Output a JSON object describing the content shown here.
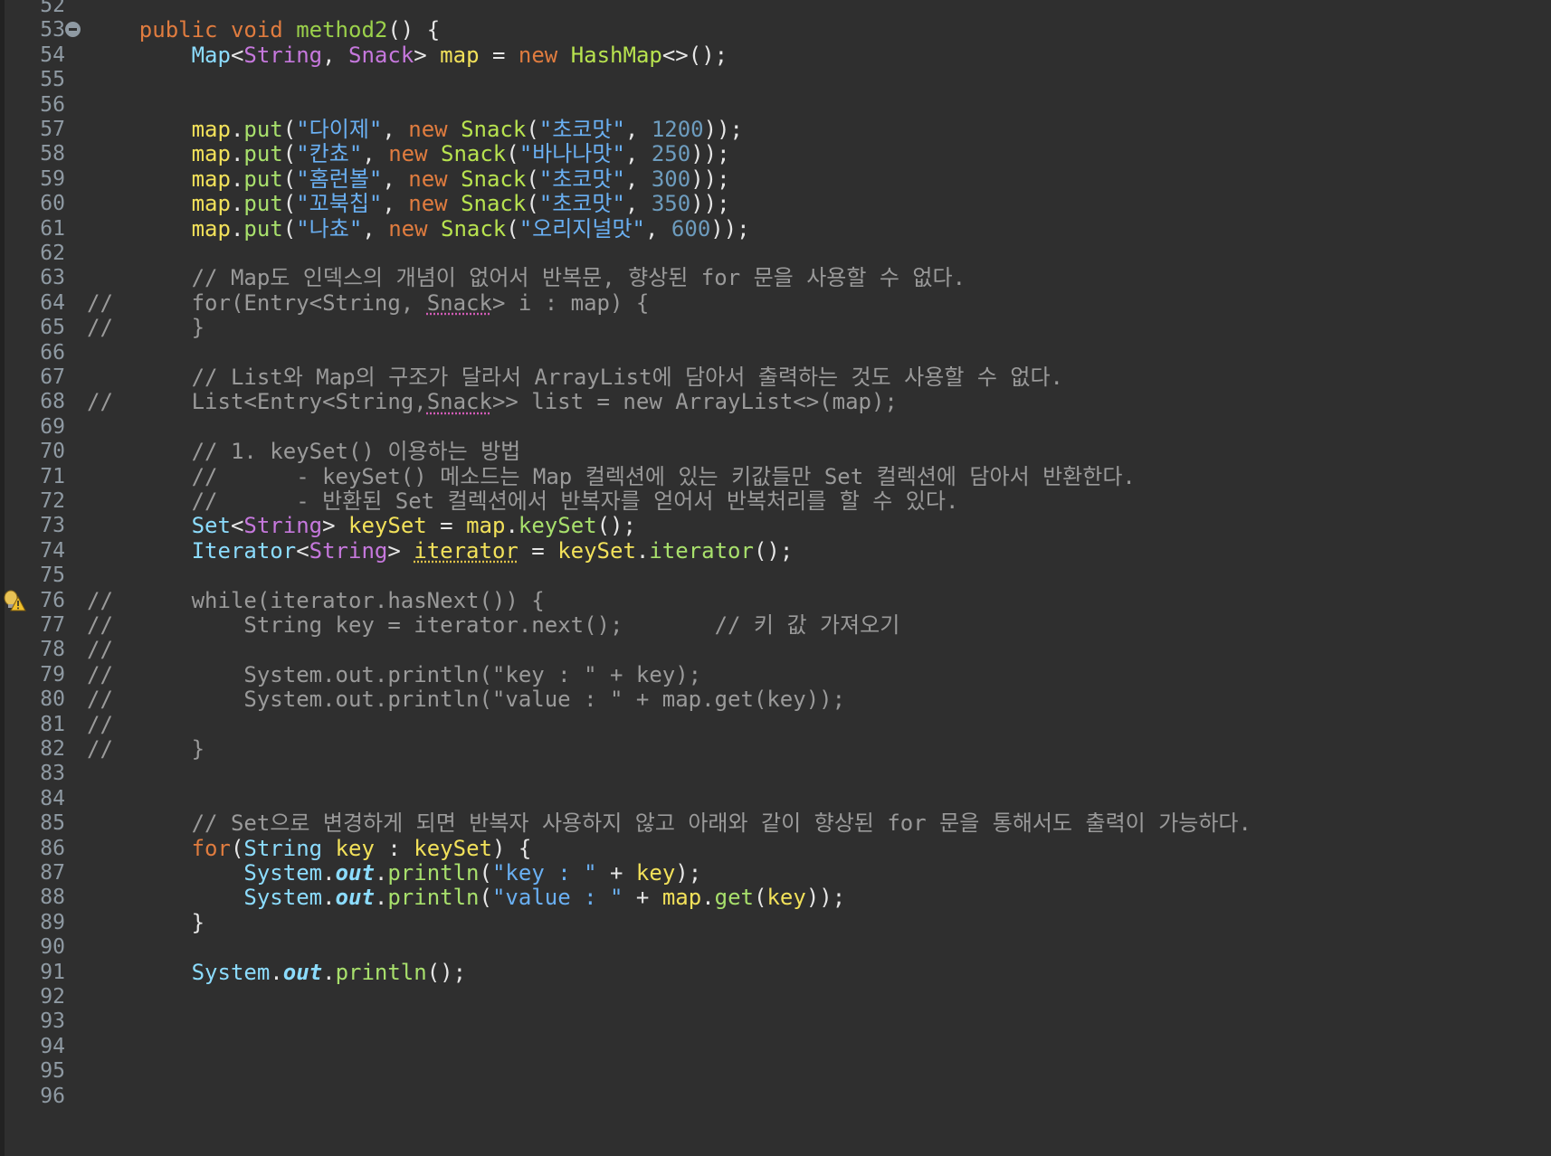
{
  "colors": {
    "background": "#2f2f2f",
    "line_number": "#8f9aa3",
    "keyword": "#e07c3f",
    "method_name": "#9bd14b",
    "interface_type": "#8cdcfe",
    "class_type": "#c678dd",
    "string": "#6ab0f3",
    "constructor": "#b8e34f",
    "local_variable": "#f2e15a",
    "number": "#6d9cbe",
    "method_call": "#a8e06c",
    "comment": "#9a9a9a",
    "plain": "#e6e6e6"
  },
  "icons": {
    "fold": "collapse-minus-icon",
    "warning": "warning-lightbulb-icon"
  },
  "lines": [
    {
      "n": "52",
      "tokens": []
    },
    {
      "n": "53",
      "tokens": [
        {
          "t": "    "
        },
        {
          "t": "public",
          "c": "kw"
        },
        {
          "t": " "
        },
        {
          "t": "void",
          "c": "kw"
        },
        {
          "t": " "
        },
        {
          "t": "method2",
          "c": "method"
        },
        {
          "t": "() {"
        }
      ]
    },
    {
      "n": "54",
      "tokens": [
        {
          "t": "        "
        },
        {
          "t": "Map",
          "c": "iface"
        },
        {
          "t": "<"
        },
        {
          "t": "String",
          "c": "type"
        },
        {
          "t": ", "
        },
        {
          "t": "Snack",
          "c": "type"
        },
        {
          "t": "> "
        },
        {
          "t": "map",
          "c": "field"
        },
        {
          "t": " = "
        },
        {
          "t": "new",
          "c": "kw"
        },
        {
          "t": " "
        },
        {
          "t": "HashMap",
          "c": "ctor"
        },
        {
          "t": "<>();"
        }
      ]
    },
    {
      "n": "55",
      "tokens": []
    },
    {
      "n": "56",
      "tokens": []
    },
    {
      "n": "57",
      "tokens": [
        {
          "t": "        "
        },
        {
          "t": "map",
          "c": "field"
        },
        {
          "t": "."
        },
        {
          "t": "put",
          "c": "call"
        },
        {
          "t": "("
        },
        {
          "t": "\"다이제\"",
          "c": "str"
        },
        {
          "t": ", "
        },
        {
          "t": "new",
          "c": "kw"
        },
        {
          "t": " "
        },
        {
          "t": "Snack",
          "c": "ctor"
        },
        {
          "t": "("
        },
        {
          "t": "\"초코맛\"",
          "c": "str"
        },
        {
          "t": ", "
        },
        {
          "t": "1200",
          "c": "num"
        },
        {
          "t": "));"
        }
      ]
    },
    {
      "n": "58",
      "tokens": [
        {
          "t": "        "
        },
        {
          "t": "map",
          "c": "field"
        },
        {
          "t": "."
        },
        {
          "t": "put",
          "c": "call"
        },
        {
          "t": "("
        },
        {
          "t": "\"칸쵸\"",
          "c": "str"
        },
        {
          "t": ", "
        },
        {
          "t": "new",
          "c": "kw"
        },
        {
          "t": " "
        },
        {
          "t": "Snack",
          "c": "ctor"
        },
        {
          "t": "("
        },
        {
          "t": "\"바나나맛\"",
          "c": "str"
        },
        {
          "t": ", "
        },
        {
          "t": "250",
          "c": "num"
        },
        {
          "t": "));"
        }
      ]
    },
    {
      "n": "59",
      "tokens": [
        {
          "t": "        "
        },
        {
          "t": "map",
          "c": "field"
        },
        {
          "t": "."
        },
        {
          "t": "put",
          "c": "call"
        },
        {
          "t": "("
        },
        {
          "t": "\"홈런볼\"",
          "c": "str"
        },
        {
          "t": ", "
        },
        {
          "t": "new",
          "c": "kw"
        },
        {
          "t": " "
        },
        {
          "t": "Snack",
          "c": "ctor"
        },
        {
          "t": "("
        },
        {
          "t": "\"초코맛\"",
          "c": "str"
        },
        {
          "t": ", "
        },
        {
          "t": "300",
          "c": "num"
        },
        {
          "t": "));"
        }
      ]
    },
    {
      "n": "60",
      "tokens": [
        {
          "t": "        "
        },
        {
          "t": "map",
          "c": "field"
        },
        {
          "t": "."
        },
        {
          "t": "put",
          "c": "call"
        },
        {
          "t": "("
        },
        {
          "t": "\"꼬북칩\"",
          "c": "str"
        },
        {
          "t": ", "
        },
        {
          "t": "new",
          "c": "kw"
        },
        {
          "t": " "
        },
        {
          "t": "Snack",
          "c": "ctor"
        },
        {
          "t": "("
        },
        {
          "t": "\"초코맛\"",
          "c": "str"
        },
        {
          "t": ", "
        },
        {
          "t": "350",
          "c": "num"
        },
        {
          "t": "));"
        }
      ]
    },
    {
      "n": "61",
      "tokens": [
        {
          "t": "        "
        },
        {
          "t": "map",
          "c": "field"
        },
        {
          "t": "."
        },
        {
          "t": "put",
          "c": "call"
        },
        {
          "t": "("
        },
        {
          "t": "\"나쵸\"",
          "c": "str"
        },
        {
          "t": ", "
        },
        {
          "t": "new",
          "c": "kw"
        },
        {
          "t": " "
        },
        {
          "t": "Snack",
          "c": "ctor"
        },
        {
          "t": "("
        },
        {
          "t": "\"오리지널맛\"",
          "c": "str"
        },
        {
          "t": ", "
        },
        {
          "t": "600",
          "c": "num"
        },
        {
          "t": "));"
        }
      ]
    },
    {
      "n": "62",
      "tokens": []
    },
    {
      "n": "63",
      "tokens": [
        {
          "t": "        "
        },
        {
          "t": "// Map도 인덱스의 개념이 없어서 반복문, 향상된 for 문을 사용할 수 없다.",
          "c": "comment"
        }
      ]
    },
    {
      "n": "64",
      "marker": "//",
      "tokens": [
        {
          "t": "        for(Entry<String, ",
          "c": "comment"
        },
        {
          "t": "Snack",
          "c": "comment",
          "u": "squig"
        },
        {
          "t": "> i : map) {",
          "c": "comment"
        }
      ]
    },
    {
      "n": "65",
      "marker": "//",
      "tokens": [
        {
          "t": "        }",
          "c": "comment"
        }
      ]
    },
    {
      "n": "66",
      "tokens": []
    },
    {
      "n": "67",
      "tokens": [
        {
          "t": "        "
        },
        {
          "t": "// List와 Map의 구조가 달라서 ArrayList에 담아서 출력하는 것도 사용할 수 없다.",
          "c": "comment"
        }
      ]
    },
    {
      "n": "68",
      "marker": "//",
      "tokens": [
        {
          "t": "        List<Entry<String,",
          "c": "comment"
        },
        {
          "t": "Snack",
          "c": "comment",
          "u": "squig"
        },
        {
          "t": ">> list = new ArrayList<>(map);",
          "c": "comment"
        }
      ]
    },
    {
      "n": "69",
      "tokens": []
    },
    {
      "n": "70",
      "tokens": [
        {
          "t": "        "
        },
        {
          "t": "// 1. keySet() 이용하는 방법",
          "c": "comment"
        }
      ]
    },
    {
      "n": "71",
      "tokens": [
        {
          "t": "        "
        },
        {
          "t": "//      - keySet() 메소드는 Map 컬렉션에 있는 키값들만 Set 컬렉션에 담아서 반환한다.",
          "c": "comment"
        }
      ]
    },
    {
      "n": "72",
      "tokens": [
        {
          "t": "        "
        },
        {
          "t": "//      - 반환된 Set 컬렉션에서 반복자를 얻어서 반복처리를 할 수 있다.",
          "c": "comment"
        }
      ]
    },
    {
      "n": "73",
      "tokens": [
        {
          "t": "        "
        },
        {
          "t": "Set",
          "c": "iface"
        },
        {
          "t": "<"
        },
        {
          "t": "String",
          "c": "type"
        },
        {
          "t": "> "
        },
        {
          "t": "keySet",
          "c": "field"
        },
        {
          "t": " = "
        },
        {
          "t": "map",
          "c": "field"
        },
        {
          "t": "."
        },
        {
          "t": "keySet",
          "c": "call"
        },
        {
          "t": "();"
        }
      ]
    },
    {
      "n": "74",
      "tokens": [
        {
          "t": "        "
        },
        {
          "t": "Iterator",
          "c": "iface"
        },
        {
          "t": "<"
        },
        {
          "t": "String",
          "c": "type"
        },
        {
          "t": "> "
        },
        {
          "t": "iterator",
          "c": "field",
          "u": "warn"
        },
        {
          "t": " = "
        },
        {
          "t": "keySet",
          "c": "field"
        },
        {
          "t": "."
        },
        {
          "t": "iterator",
          "c": "call"
        },
        {
          "t": "();"
        }
      ]
    },
    {
      "n": "75",
      "tokens": []
    },
    {
      "n": "76",
      "marker": "//",
      "tokens": [
        {
          "t": "        while(iterator.hasNext()) {",
          "c": "comment"
        }
      ]
    },
    {
      "n": "77",
      "marker": "//",
      "tokens": [
        {
          "t": "            String key = iterator.next();       // 키 값 가져오기",
          "c": "comment"
        }
      ]
    },
    {
      "n": "78",
      "marker": "//",
      "tokens": []
    },
    {
      "n": "79",
      "marker": "//",
      "tokens": [
        {
          "t": "            System.out.println(\"key : \" + key);",
          "c": "comment"
        }
      ]
    },
    {
      "n": "80",
      "marker": "//",
      "tokens": [
        {
          "t": "            System.out.println(\"value : \" + map.get(key));",
          "c": "comment"
        }
      ]
    },
    {
      "n": "81",
      "marker": "//",
      "tokens": []
    },
    {
      "n": "82",
      "marker": "//",
      "tokens": [
        {
          "t": "        }",
          "c": "comment"
        }
      ]
    },
    {
      "n": "83",
      "tokens": []
    },
    {
      "n": "84",
      "tokens": []
    },
    {
      "n": "85",
      "tokens": [
        {
          "t": "        "
        },
        {
          "t": "// Set으로 변경하게 되면 반복자 사용하지 않고 아래와 같이 향상된 for 문을 통해서도 출력이 가능하다.",
          "c": "comment"
        }
      ]
    },
    {
      "n": "86",
      "tokens": [
        {
          "t": "        "
        },
        {
          "t": "for",
          "c": "kw"
        },
        {
          "t": "("
        },
        {
          "t": "String",
          "c": "iface"
        },
        {
          "t": " "
        },
        {
          "t": "key",
          "c": "field"
        },
        {
          "t": " : "
        },
        {
          "t": "keySet",
          "c": "field"
        },
        {
          "t": ") {"
        }
      ]
    },
    {
      "n": "87",
      "tokens": [
        {
          "t": "            "
        },
        {
          "t": "System",
          "c": "iface"
        },
        {
          "t": "."
        },
        {
          "t": "out",
          "c": "static"
        },
        {
          "t": "."
        },
        {
          "t": "println",
          "c": "call"
        },
        {
          "t": "("
        },
        {
          "t": "\"key : \"",
          "c": "str"
        },
        {
          "t": " + "
        },
        {
          "t": "key",
          "c": "field"
        },
        {
          "t": ");"
        }
      ]
    },
    {
      "n": "88",
      "tokens": [
        {
          "t": "            "
        },
        {
          "t": "System",
          "c": "iface"
        },
        {
          "t": "."
        },
        {
          "t": "out",
          "c": "static"
        },
        {
          "t": "."
        },
        {
          "t": "println",
          "c": "call"
        },
        {
          "t": "("
        },
        {
          "t": "\"value : \"",
          "c": "str"
        },
        {
          "t": " + "
        },
        {
          "t": "map",
          "c": "field"
        },
        {
          "t": "."
        },
        {
          "t": "get",
          "c": "call"
        },
        {
          "t": "("
        },
        {
          "t": "key",
          "c": "field"
        },
        {
          "t": "));"
        }
      ]
    },
    {
      "n": "89",
      "tokens": [
        {
          "t": "        }"
        }
      ]
    },
    {
      "n": "90",
      "tokens": []
    },
    {
      "n": "91",
      "tokens": [
        {
          "t": "        "
        },
        {
          "t": "System",
          "c": "iface"
        },
        {
          "t": "."
        },
        {
          "t": "out",
          "c": "static"
        },
        {
          "t": "."
        },
        {
          "t": "println",
          "c": "call"
        },
        {
          "t": "();"
        }
      ]
    },
    {
      "n": "92",
      "tokens": []
    },
    {
      "n": "93",
      "tokens": []
    },
    {
      "n": "94",
      "tokens": []
    },
    {
      "n": "95",
      "tokens": []
    },
    {
      "n": "96",
      "tokens": []
    }
  ]
}
